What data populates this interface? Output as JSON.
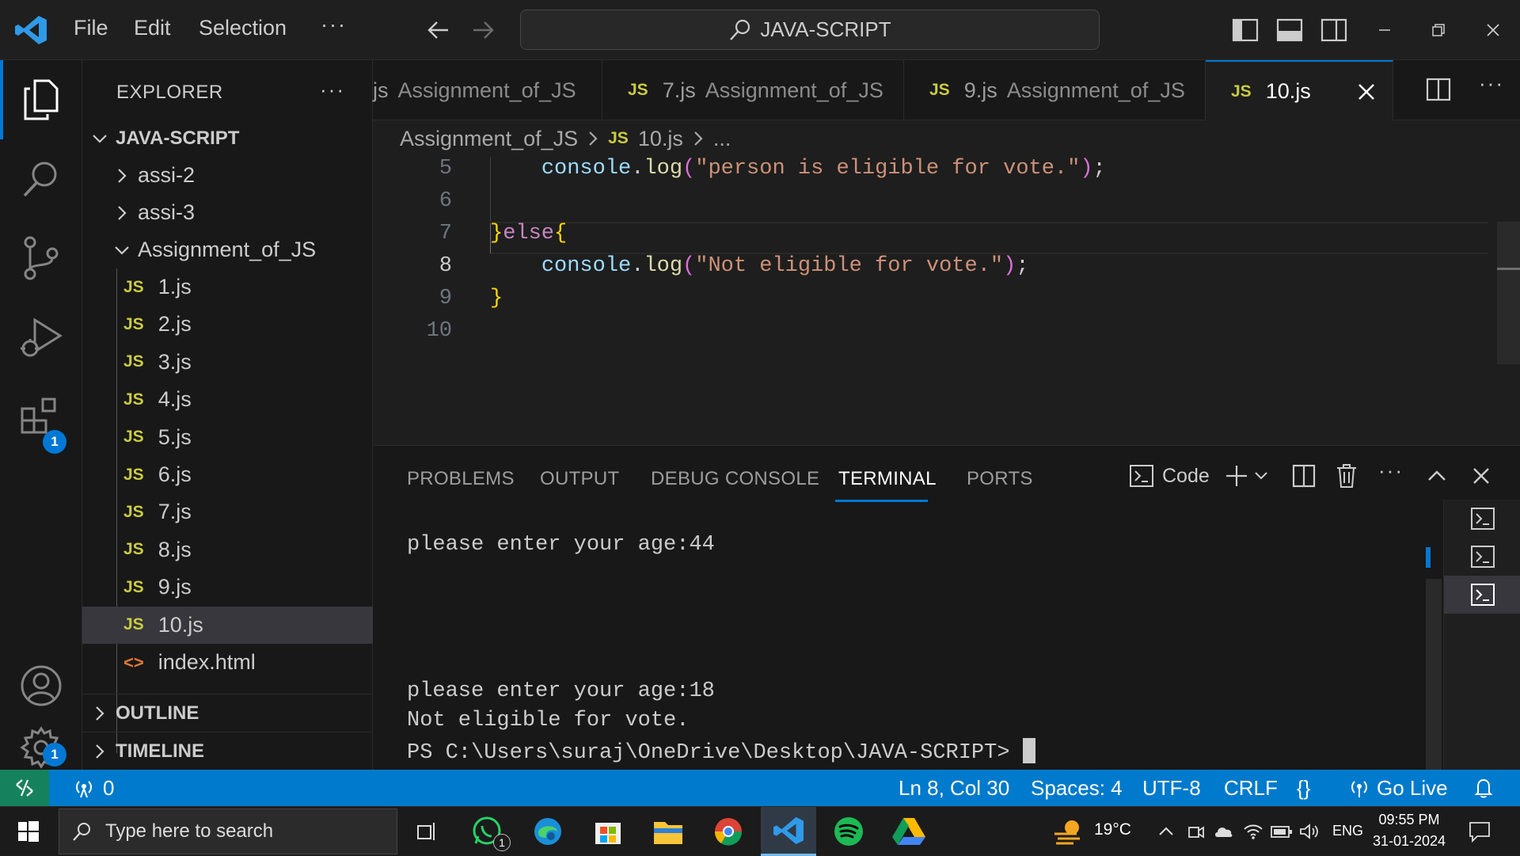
{
  "titlebar": {
    "menu": [
      "File",
      "Edit",
      "Selection",
      "···"
    ],
    "search_text": "JAVA-SCRIPT"
  },
  "activity": {
    "extensions_badge": "1",
    "settings_badge": "1"
  },
  "sidebar": {
    "title": "EXPLORER",
    "workspace": "JAVA-SCRIPT",
    "folders": [
      "assi-2",
      "assi-3",
      "Assignment_of_JS"
    ],
    "files": [
      "1.js",
      "2.js",
      "3.js",
      "4.js",
      "5.js",
      "6.js",
      "7.js",
      "8.js",
      "9.js",
      "10.js",
      "index.html"
    ],
    "outline": "OUTLINE",
    "timeline": "TIMELINE",
    "js_badge": "JS",
    "html_badge": "<>"
  },
  "tabs": [
    {
      "name": "js",
      "desc": "Assignment_of_JS"
    },
    {
      "name": "7.js",
      "desc": "Assignment_of_JS"
    },
    {
      "name": "9.js",
      "desc": "Assignment_of_JS"
    },
    {
      "name": "10.js",
      "desc": ""
    }
  ],
  "breadcrumb": {
    "folder": "Assignment_of_JS",
    "file": "10.js",
    "more": "..."
  },
  "editor": {
    "line_numbers": [
      "5",
      "6",
      "7",
      "8",
      "9",
      "10"
    ],
    "active_line": "8"
  },
  "panel": {
    "tabs": [
      "PROBLEMS",
      "OUTPUT",
      "DEBUG CONSOLE",
      "TERMINAL",
      "PORTS"
    ],
    "active_tab": "TERMINAL",
    "terminal_name": "Code",
    "lines": [
      "please enter your age:44",
      "please enter your age:18",
      "Not eligible for vote.",
      "PS C:\\Users\\suraj\\OneDrive\\Desktop\\JAVA-SCRIPT> "
    ]
  },
  "statusbar": {
    "ports": "0",
    "position": "Ln 8, Col 30",
    "spaces": "Spaces: 4",
    "encoding": "UTF-8",
    "eol": "CRLF",
    "lang": "{}",
    "golive": "Go Live"
  },
  "taskbar": {
    "search_placeholder": "Type here to search",
    "whatsapp_badge": "1",
    "temperature": "19°C",
    "lang": "ENG",
    "time": "09:55 PM",
    "date": "31-01-2024"
  },
  "colors": {
    "accent": "#007acc",
    "js_yellow": "#cbcb41",
    "string": "#ce9178",
    "function": "#dcdcaa",
    "variable": "#9cdcfe",
    "bracket": "#ffd700",
    "keyword": "#c586c0"
  }
}
